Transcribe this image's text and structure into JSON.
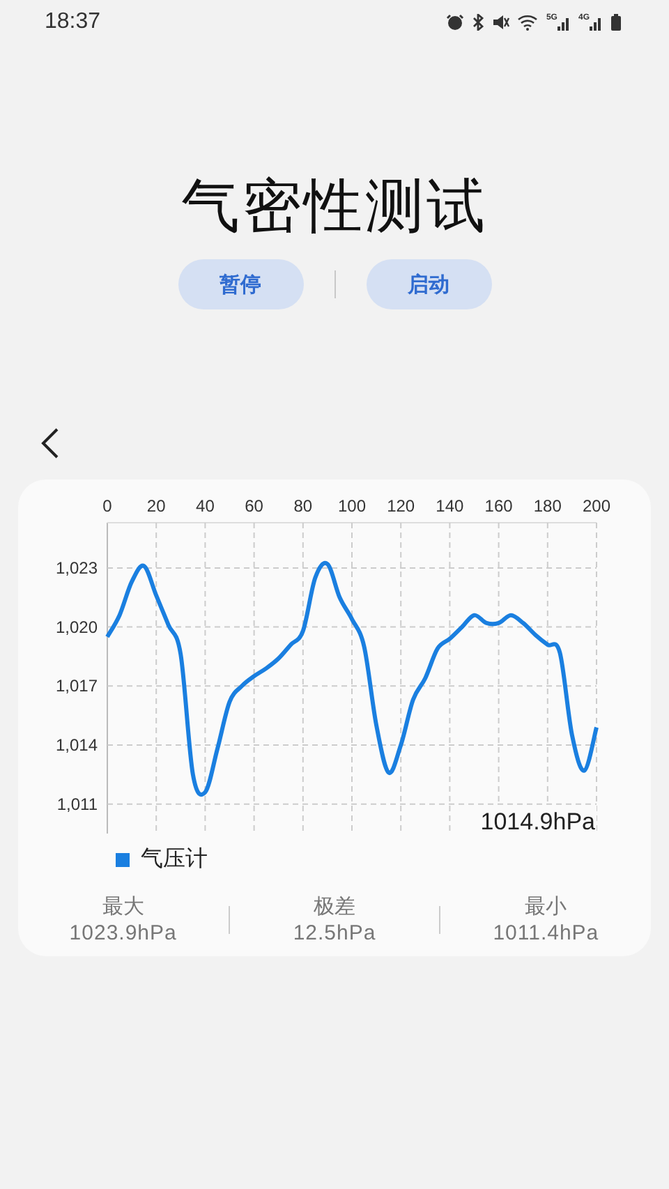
{
  "status_bar": {
    "time": "18:37",
    "networks": [
      "5G",
      "4G"
    ]
  },
  "title": "气密性测试",
  "buttons": [
    {
      "label": "暂停"
    },
    {
      "label": "启动"
    }
  ],
  "chart_card": {
    "chart_data": {
      "type": "line",
      "grid": true,
      "xticks": [
        0,
        20,
        40,
        60,
        80,
        100,
        120,
        140,
        160,
        180,
        200
      ],
      "yticks": [
        {
          "value": 1011,
          "label": "1,011"
        },
        {
          "value": 1014,
          "label": "1,014"
        },
        {
          "value": 1017,
          "label": "1,017"
        },
        {
          "value": 1020,
          "label": "1,020"
        },
        {
          "value": 1023,
          "label": "1,023"
        }
      ],
      "xlim": [
        0,
        200
      ],
      "ylim": [
        1009.5,
        1025.3
      ],
      "x": [
        0,
        5,
        10,
        15,
        20,
        25,
        30,
        35,
        40,
        45,
        50,
        55,
        60,
        65,
        70,
        75,
        80,
        85,
        90,
        95,
        100,
        105,
        110,
        115,
        120,
        125,
        130,
        135,
        140,
        145,
        150,
        155,
        160,
        165,
        170,
        175,
        180,
        185,
        190,
        195,
        200
      ],
      "series": [
        {
          "name": "气压计",
          "color": "#1a7fe0",
          "values": [
            1019.5,
            1020.6,
            1022.3,
            1023.1,
            1021.6,
            1020.1,
            1018.6,
            1012.5,
            1011.6,
            1013.8,
            1016.2,
            1017.0,
            1017.5,
            1017.9,
            1018.4,
            1019.1,
            1019.8,
            1022.5,
            1023.2,
            1021.5,
            1020.4,
            1019.0,
            1015.0,
            1012.6,
            1014.0,
            1016.3,
            1017.4,
            1018.9,
            1019.4,
            1020.0,
            1020.6,
            1020.2,
            1020.2,
            1020.6,
            1020.2,
            1019.6,
            1019.1,
            1018.7,
            1014.5,
            1012.7,
            1014.9
          ]
        }
      ]
    },
    "current_value": "1014.9hPa",
    "stats": [
      {
        "label": "最大",
        "value": "1023.9hPa"
      },
      {
        "label": "极差",
        "value": "12.5hPa"
      },
      {
        "label": "最小",
        "value": "1011.4hPa"
      }
    ]
  }
}
